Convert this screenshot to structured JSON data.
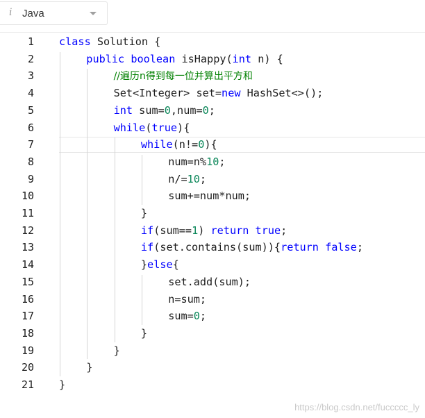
{
  "language_select": {
    "icon": "info-icon",
    "icon_glyph": "i",
    "value": "Java"
  },
  "editor": {
    "active_line": 7,
    "lines": [
      {
        "number": "1",
        "indent": 0,
        "tokens": [
          {
            "t": "class",
            "c": "kw"
          },
          {
            "t": " Solution {",
            "c": "plain"
          }
        ]
      },
      {
        "number": "2",
        "indent": 1,
        "tokens": [
          {
            "t": "public",
            "c": "kw"
          },
          {
            "t": " ",
            "c": "plain"
          },
          {
            "t": "boolean",
            "c": "kw"
          },
          {
            "t": " isHappy(",
            "c": "plain"
          },
          {
            "t": "int",
            "c": "kw"
          },
          {
            "t": " n) {",
            "c": "plain"
          }
        ]
      },
      {
        "number": "3",
        "indent": 2,
        "tokens": [
          {
            "t": "//遍历n得到每一位并算出平方和",
            "c": "cmt"
          }
        ]
      },
      {
        "number": "4",
        "indent": 2,
        "tokens": [
          {
            "t": "Set<Integer> set=",
            "c": "plain"
          },
          {
            "t": "new",
            "c": "kw"
          },
          {
            "t": " HashSet<>();",
            "c": "plain"
          }
        ]
      },
      {
        "number": "5",
        "indent": 2,
        "tokens": [
          {
            "t": "int",
            "c": "kw"
          },
          {
            "t": " sum=",
            "c": "plain"
          },
          {
            "t": "0",
            "c": "num"
          },
          {
            "t": ",num=",
            "c": "plain"
          },
          {
            "t": "0",
            "c": "num"
          },
          {
            "t": ";",
            "c": "plain"
          }
        ]
      },
      {
        "number": "6",
        "indent": 2,
        "tokens": [
          {
            "t": "while",
            "c": "kw"
          },
          {
            "t": "(",
            "c": "plain"
          },
          {
            "t": "true",
            "c": "kw"
          },
          {
            "t": "){",
            "c": "plain"
          }
        ]
      },
      {
        "number": "7",
        "indent": 3,
        "tokens": [
          {
            "t": "while",
            "c": "kw"
          },
          {
            "t": "(n!=",
            "c": "plain"
          },
          {
            "t": "0",
            "c": "num"
          },
          {
            "t": "){",
            "c": "plain"
          }
        ]
      },
      {
        "number": "8",
        "indent": 4,
        "tokens": [
          {
            "t": "num=n%",
            "c": "plain"
          },
          {
            "t": "10",
            "c": "num"
          },
          {
            "t": ";",
            "c": "plain"
          }
        ]
      },
      {
        "number": "9",
        "indent": 4,
        "tokens": [
          {
            "t": "n/=",
            "c": "plain"
          },
          {
            "t": "10",
            "c": "num"
          },
          {
            "t": ";",
            "c": "plain"
          }
        ]
      },
      {
        "number": "10",
        "indent": 4,
        "tokens": [
          {
            "t": "sum+=num*num;",
            "c": "plain"
          }
        ]
      },
      {
        "number": "11",
        "indent": 3,
        "tokens": [
          {
            "t": "}",
            "c": "plain"
          }
        ]
      },
      {
        "number": "12",
        "indent": 3,
        "tokens": [
          {
            "t": "if",
            "c": "kw"
          },
          {
            "t": "(sum==",
            "c": "plain"
          },
          {
            "t": "1",
            "c": "num"
          },
          {
            "t": ") ",
            "c": "plain"
          },
          {
            "t": "return",
            "c": "kw"
          },
          {
            "t": " ",
            "c": "plain"
          },
          {
            "t": "true",
            "c": "kw"
          },
          {
            "t": ";",
            "c": "plain"
          }
        ]
      },
      {
        "number": "13",
        "indent": 3,
        "tokens": [
          {
            "t": "if",
            "c": "kw"
          },
          {
            "t": "(set.contains(sum)){",
            "c": "plain"
          },
          {
            "t": "return",
            "c": "kw"
          },
          {
            "t": " ",
            "c": "plain"
          },
          {
            "t": "false",
            "c": "kw"
          },
          {
            "t": ";",
            "c": "plain"
          }
        ]
      },
      {
        "number": "14",
        "indent": 3,
        "tokens": [
          {
            "t": "}",
            "c": "plain"
          },
          {
            "t": "else",
            "c": "kw"
          },
          {
            "t": "{",
            "c": "plain"
          }
        ]
      },
      {
        "number": "15",
        "indent": 4,
        "tokens": [
          {
            "t": "set.add(sum);",
            "c": "plain"
          }
        ]
      },
      {
        "number": "16",
        "indent": 4,
        "tokens": [
          {
            "t": "n=sum;",
            "c": "plain"
          }
        ]
      },
      {
        "number": "17",
        "indent": 4,
        "tokens": [
          {
            "t": "sum=",
            "c": "plain"
          },
          {
            "t": "0",
            "c": "num"
          },
          {
            "t": ";",
            "c": "plain"
          }
        ]
      },
      {
        "number": "18",
        "indent": 3,
        "tokens": [
          {
            "t": "}",
            "c": "plain"
          }
        ]
      },
      {
        "number": "19",
        "indent": 2,
        "tokens": [
          {
            "t": "}",
            "c": "plain"
          }
        ]
      },
      {
        "number": "20",
        "indent": 1,
        "tokens": [
          {
            "t": "}",
            "c": "plain"
          }
        ]
      },
      {
        "number": "21",
        "indent": 0,
        "tokens": [
          {
            "t": "}",
            "c": "plain"
          }
        ]
      }
    ]
  },
  "colors": {
    "keyword": "#0000ff",
    "number": "#098658",
    "comment": "#008000",
    "text": "#1e1e1e"
  },
  "watermark": "https://blog.csdn.net/fuccccc_ly"
}
